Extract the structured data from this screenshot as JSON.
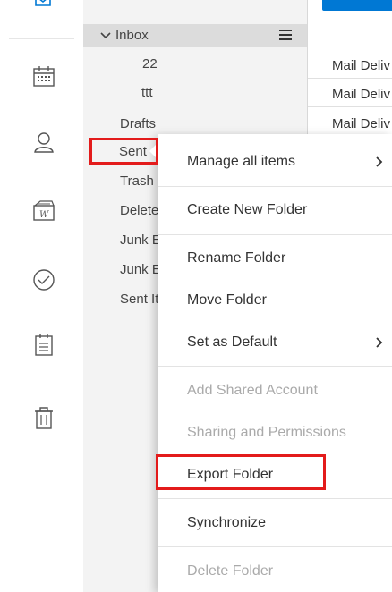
{
  "folder_pane": {
    "title": "",
    "inbox": {
      "label": "Inbox",
      "children": [
        "22",
        "ttt"
      ]
    },
    "folders": [
      "Drafts",
      "Sent",
      "Trash",
      "Deleted",
      "Junk E-",
      "Junk Er",
      "Sent Ite"
    ]
  },
  "message_list": {
    "rows": [
      "Mail Deliv",
      "Mail Deliv",
      "Mail Deliv"
    ]
  },
  "context_menu": {
    "items": [
      {
        "label": "Manage all items",
        "enabled": true,
        "submenu": true
      },
      {
        "label": "Create New Folder",
        "enabled": true,
        "submenu": false
      },
      {
        "label": "Rename Folder",
        "enabled": true,
        "submenu": false
      },
      {
        "label": "Move Folder",
        "enabled": true,
        "submenu": false
      },
      {
        "label": "Set as Default",
        "enabled": true,
        "submenu": true
      },
      {
        "label": "Add Shared Account",
        "enabled": false,
        "submenu": false
      },
      {
        "label": "Sharing and Permissions",
        "enabled": false,
        "submenu": false
      },
      {
        "label": "Export Folder",
        "enabled": true,
        "submenu": false
      },
      {
        "label": "Synchronize",
        "enabled": true,
        "submenu": false
      },
      {
        "label": "Delete Folder",
        "enabled": false,
        "submenu": false
      }
    ]
  },
  "highlights": [
    "Sent",
    "Export Folder"
  ],
  "colors": {
    "accent": "#0078d4",
    "highlight": "#e31b1b",
    "pane_bg": "#f3f3f3"
  },
  "icons": [
    "mail-icon",
    "calendar-icon",
    "contacts-icon",
    "briefcase-icon",
    "tasks-icon",
    "notes-icon",
    "trash-icon"
  ]
}
